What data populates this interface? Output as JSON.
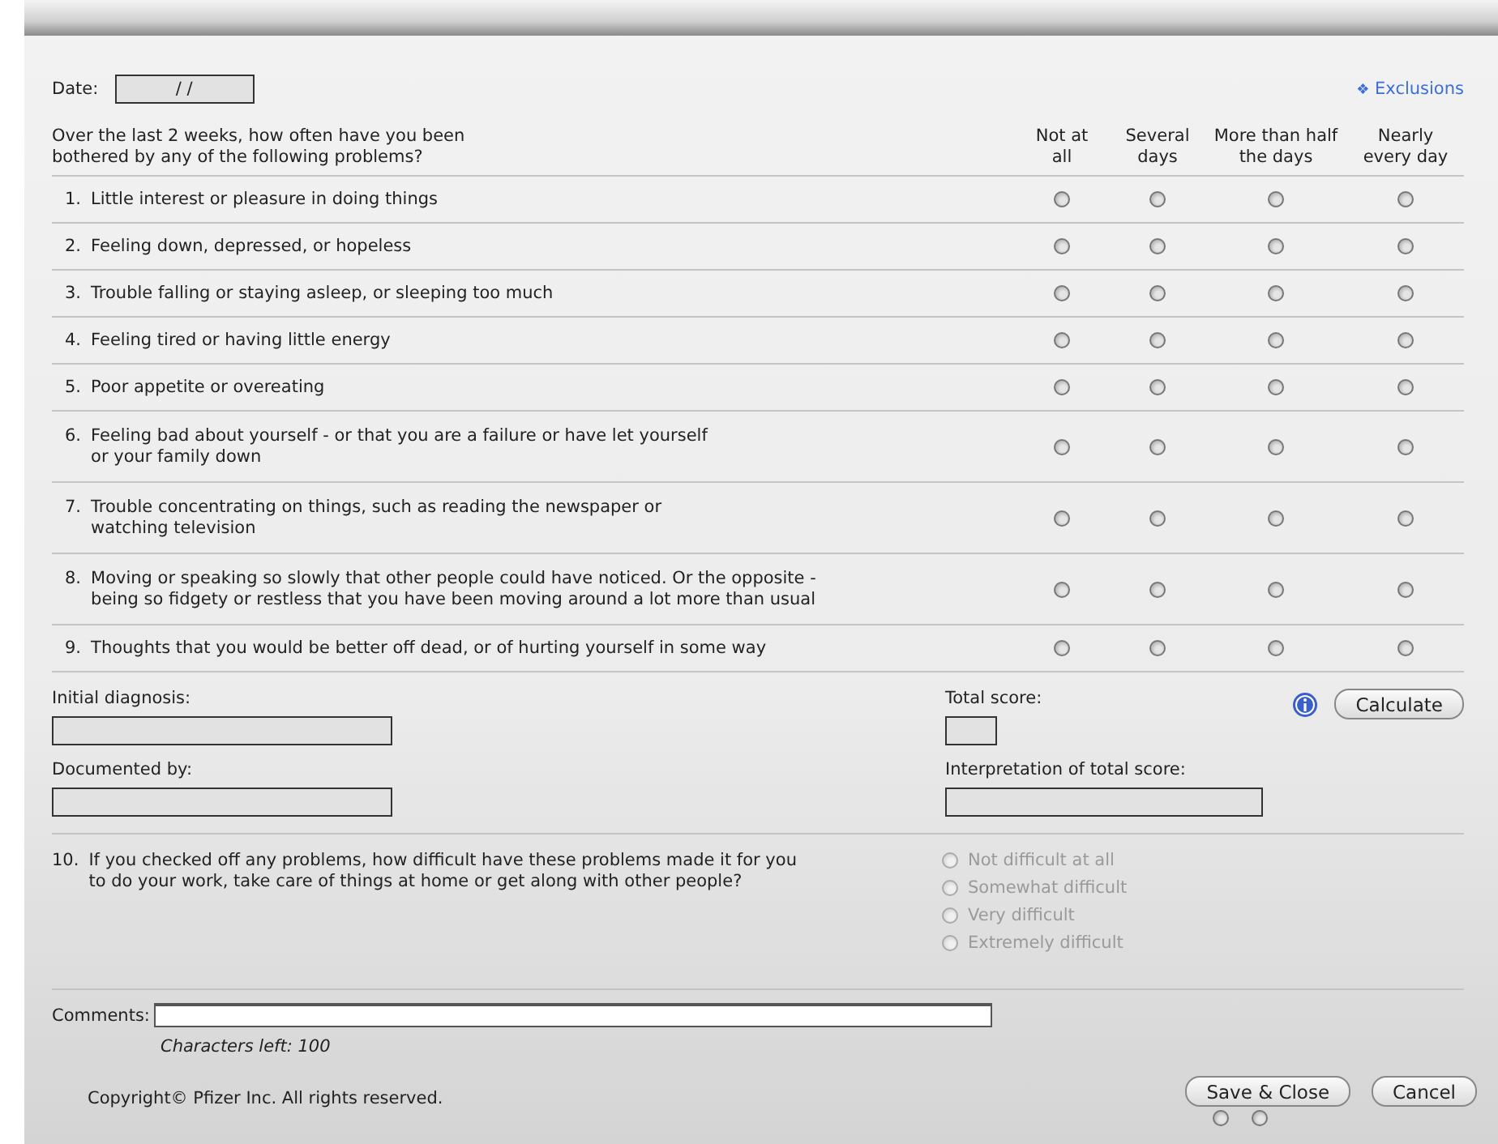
{
  "date": {
    "label": "Date:",
    "value": "/ /"
  },
  "exclusions_link": {
    "icon": "❖",
    "label": "Exclusions"
  },
  "prompt": [
    "Over the last 2 weeks, how often have you been",
    "bothered by any of the following problems?"
  ],
  "columns": [
    [
      "Not at",
      "all"
    ],
    [
      "Several",
      "days"
    ],
    [
      "More than half",
      "the days"
    ],
    [
      "Nearly",
      "every day"
    ]
  ],
  "questions": [
    {
      "number": "1.",
      "lines": [
        "Little interest or pleasure in doing things"
      ],
      "answers": [
        {
          "selected": false
        },
        {
          "selected": false
        },
        {
          "selected": false
        },
        {
          "selected": false
        }
      ]
    },
    {
      "number": "2.",
      "lines": [
        "Feeling down, depressed, or hopeless"
      ],
      "answers": [
        {
          "selected": false
        },
        {
          "selected": false
        },
        {
          "selected": false
        },
        {
          "selected": false
        }
      ]
    },
    {
      "number": "3.",
      "lines": [
        "Trouble falling or staying asleep, or sleeping too much"
      ],
      "answers": [
        {
          "selected": false
        },
        {
          "selected": false
        },
        {
          "selected": false
        },
        {
          "selected": false
        }
      ]
    },
    {
      "number": "4.",
      "lines": [
        "Feeling tired or having little energy"
      ],
      "answers": [
        {
          "selected": false
        },
        {
          "selected": false
        },
        {
          "selected": false
        },
        {
          "selected": false
        }
      ]
    },
    {
      "number": "5.",
      "lines": [
        "Poor appetite or overeating"
      ],
      "answers": [
        {
          "selected": false
        },
        {
          "selected": false
        },
        {
          "selected": false
        },
        {
          "selected": false
        }
      ]
    },
    {
      "number": "6.",
      "lines": [
        "Feeling bad about yourself - or that you are a failure or have let yourself",
        "or your family down"
      ],
      "answers": [
        {
          "selected": false
        },
        {
          "selected": false
        },
        {
          "selected": false
        },
        {
          "selected": false
        }
      ]
    },
    {
      "number": "7.",
      "lines": [
        "Trouble concentrating on things, such as reading the newspaper or",
        "watching television"
      ],
      "answers": [
        {
          "selected": false
        },
        {
          "selected": false
        },
        {
          "selected": false
        },
        {
          "selected": false
        }
      ]
    },
    {
      "number": "8.",
      "lines": [
        "Moving or speaking so slowly that other people could have noticed.  Or the opposite -",
        "being so fidgety or restless that you have been moving around a lot more than usual"
      ],
      "answers": [
        {
          "selected": false
        },
        {
          "selected": false
        },
        {
          "selected": false
        },
        {
          "selected": false
        }
      ]
    },
    {
      "number": "9.",
      "lines": [
        "Thoughts that you would be better off dead, or of hurting yourself in some way"
      ],
      "answers": [
        {
          "selected": false
        },
        {
          "selected": false
        },
        {
          "selected": false
        },
        {
          "selected": false
        }
      ]
    }
  ],
  "initial_diagnosis": {
    "label": "Initial diagnosis:"
  },
  "documented_by": {
    "label": "Documented by:"
  },
  "total_score": {
    "label": "Total score:"
  },
  "interpretation": {
    "label": "Interpretation of total score:"
  },
  "calculate_button": "Calculate",
  "question_10": {
    "number": "10.",
    "lines": [
      "If you checked off any problems, how difficult have these problems made it for you",
      "to do your work, take care of things at home or get along with other people?"
    ],
    "options": [
      {
        "label": "Not difficult at all",
        "selected": false,
        "disabled": true
      },
      {
        "label": "Somewhat difficult",
        "selected": false,
        "disabled": true
      },
      {
        "label": "Very difficult",
        "selected": false,
        "disabled": true
      },
      {
        "label": "Extremely difficult",
        "selected": false,
        "disabled": true
      }
    ]
  },
  "comments": {
    "label": "Comments:",
    "characters_left": "Characters left: 100"
  },
  "copyright": "Copyright© Pfizer Inc. All rights reserved.",
  "buttons": [
    "Save & Close",
    "Cancel"
  ],
  "footer_radios": [
    {
      "selected": false
    },
    {
      "selected": false
    }
  ]
}
